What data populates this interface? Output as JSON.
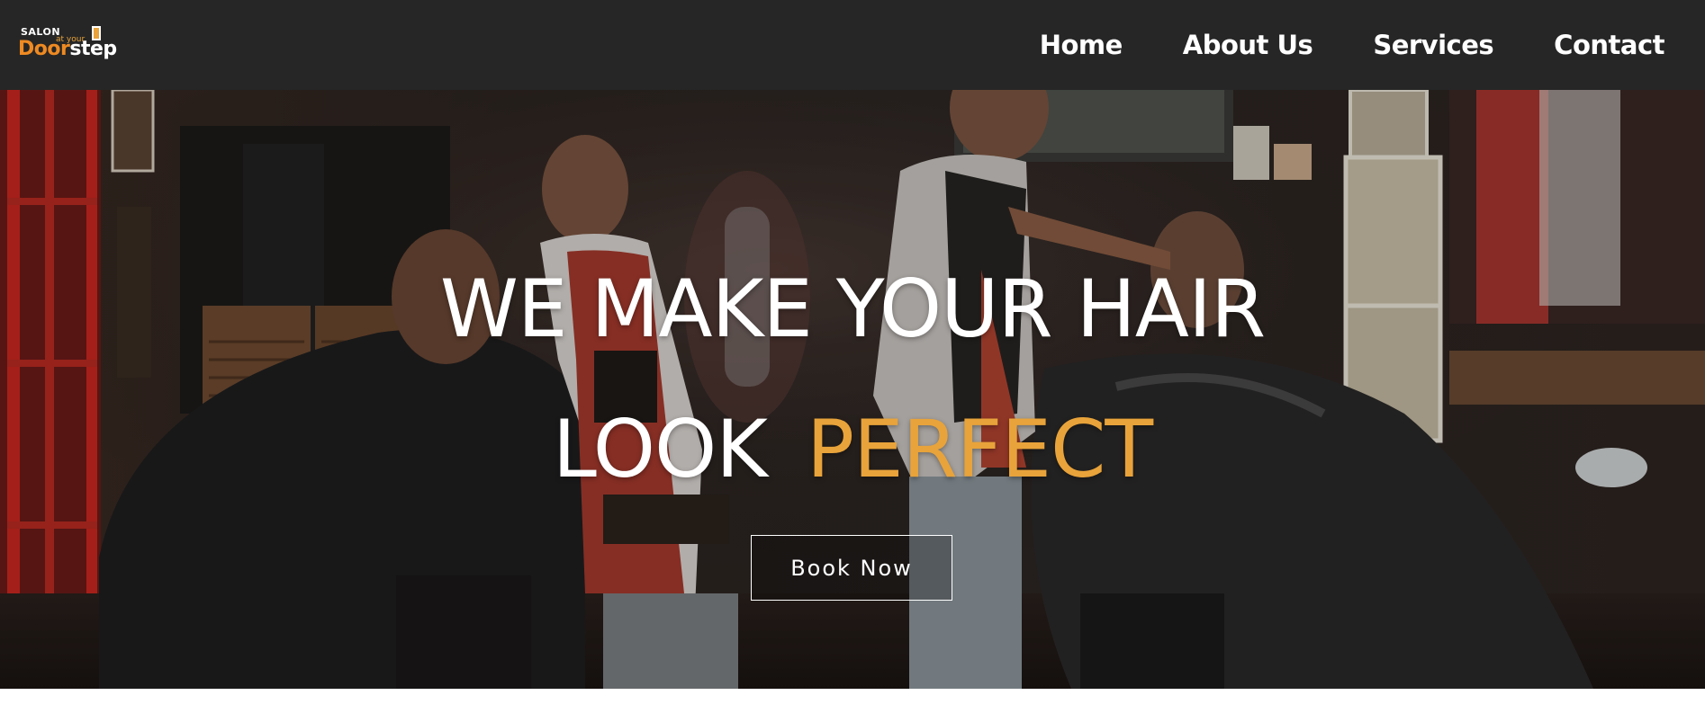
{
  "brand": {
    "salon": "SALON",
    "at_your": "at your",
    "door": "Door",
    "step": "step"
  },
  "nav": {
    "items": [
      "Home",
      "About Us",
      "Services",
      "Contact"
    ]
  },
  "hero": {
    "line1": "WE MAKE YOUR HAIR",
    "line2_white": "LOOK",
    "line2_accent": "PERFECT",
    "cta": "Book Now"
  },
  "colors": {
    "navbar_bg": "#262626",
    "accent": "#e8a33a",
    "logo_orange": "#ee8a22",
    "text": "#ffffff"
  }
}
